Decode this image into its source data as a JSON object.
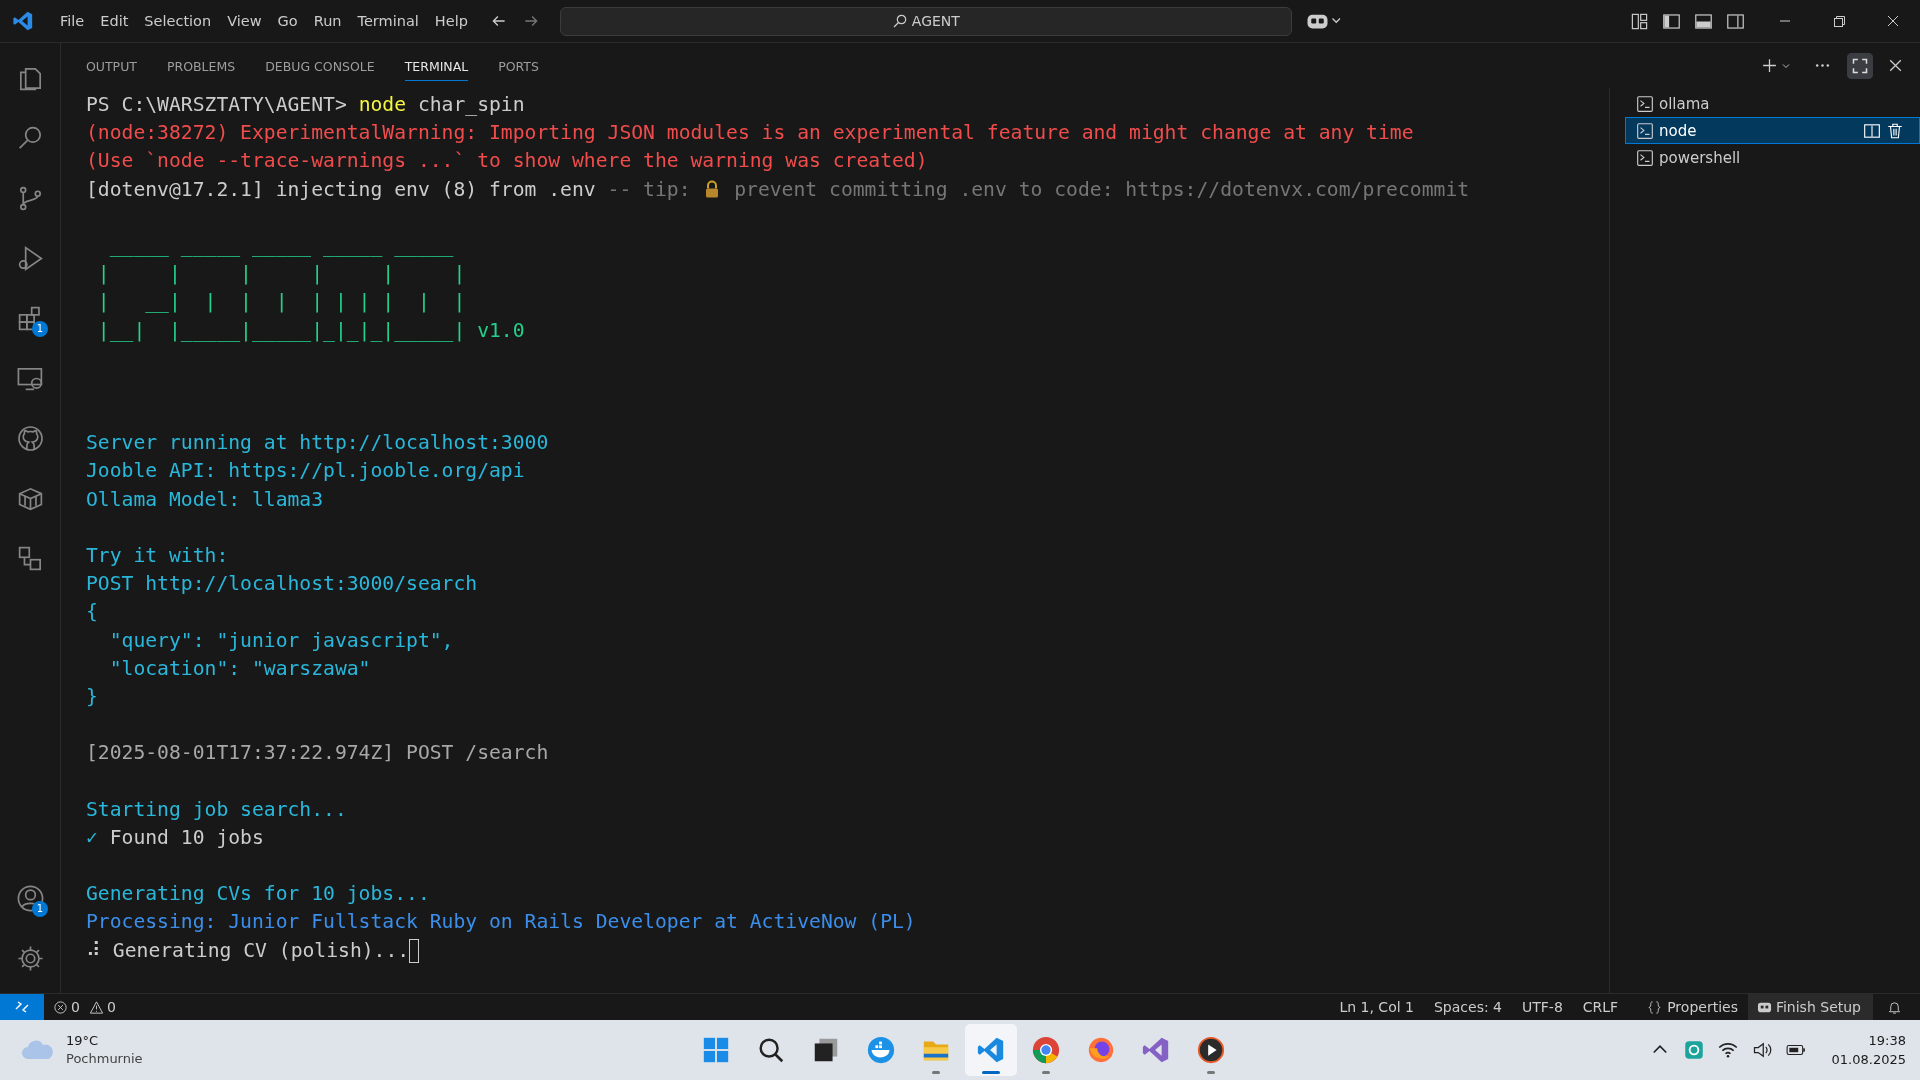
{
  "menu": [
    "File",
    "Edit",
    "Selection",
    "View",
    "Go",
    "Run",
    "Terminal",
    "Help"
  ],
  "command_center": {
    "value": "AGENT"
  },
  "activity_bar": {
    "top": [
      {
        "kind": "files"
      },
      {
        "kind": "search"
      },
      {
        "kind": "source-control"
      },
      {
        "kind": "run-debug"
      },
      {
        "kind": "extensions",
        "badge": "1"
      },
      {
        "kind": "remote"
      },
      {
        "kind": "github"
      },
      {
        "kind": "box"
      },
      {
        "kind": "shapes"
      }
    ],
    "bottom": [
      {
        "kind": "account",
        "badge": "1"
      },
      {
        "kind": "settings"
      }
    ]
  },
  "panel_tabs": [
    {
      "label": "OUTPUT",
      "selected": false
    },
    {
      "label": "PROBLEMS",
      "selected": false
    },
    {
      "label": "DEBUG CONSOLE",
      "selected": false
    },
    {
      "label": "TERMINAL",
      "selected": true
    },
    {
      "label": "PORTS",
      "selected": false
    }
  ],
  "terminal": {
    "lines": [
      {
        "kind": "text",
        "segments": [
          {
            "kind": "plain",
            "text": "PS C:\\WARSZTATY\\AGENT> "
          },
          {
            "kind": "command",
            "text": "node"
          },
          {
            "kind": "plain",
            "text": " char_spin"
          }
        ]
      },
      {
        "kind": "text",
        "segments": [
          {
            "kind": "error",
            "text": "(node:38272) ExperimentalWarning: Importing JSON modules is an experimental feature and might change at any time"
          }
        ]
      },
      {
        "kind": "text",
        "segments": [
          {
            "kind": "error",
            "text": "(Use `node --trace-warnings ...` to show where the warning was created)"
          }
        ]
      },
      {
        "kind": "text",
        "segments": [
          {
            "kind": "plain",
            "text": "[dotenv@17.2.1] injecting env (8) from .env "
          },
          {
            "kind": "dim",
            "text": "-- tip: "
          },
          {
            "kind": "lock"
          },
          {
            "kind": "dim",
            "text": " prevent committing .env to code: https://dotenvx.com/precommit"
          }
        ]
      },
      {
        "kind": "blank"
      },
      {
        "kind": "text",
        "segments": [
          {
            "kind": "art",
            "text": "  _____ _____ _____ _____ _____"
          }
        ]
      },
      {
        "kind": "text",
        "segments": [
          {
            "kind": "art",
            "text": " |     |     |     |     |     |"
          }
        ]
      },
      {
        "kind": "text",
        "segments": [
          {
            "kind": "art",
            "text": " |   __|  |  |  |  | | | |  |  |"
          }
        ]
      },
      {
        "kind": "text",
        "segments": [
          {
            "kind": "art",
            "text": " |__|  |_____|_____|_|_|_|_____|"
          },
          {
            "kind": "art",
            "text": " v1.0"
          }
        ]
      },
      {
        "kind": "blank"
      },
      {
        "kind": "blank"
      },
      {
        "kind": "blank"
      },
      {
        "kind": "text",
        "segments": [
          {
            "kind": "info",
            "text": "Server running at http://localhost:3000"
          }
        ]
      },
      {
        "kind": "text",
        "segments": [
          {
            "kind": "info",
            "text": "Jooble API: https://pl.jooble.org/api"
          }
        ]
      },
      {
        "kind": "text",
        "segments": [
          {
            "kind": "info",
            "text": "Ollama Model: llama3"
          }
        ]
      },
      {
        "kind": "blank"
      },
      {
        "kind": "text",
        "segments": [
          {
            "kind": "info",
            "text": "Try it with:"
          }
        ]
      },
      {
        "kind": "text",
        "segments": [
          {
            "kind": "info",
            "text": "POST http://localhost:3000/search"
          }
        ]
      },
      {
        "kind": "text",
        "segments": [
          {
            "kind": "info",
            "text": "{"
          }
        ]
      },
      {
        "kind": "text",
        "segments": [
          {
            "kind": "info",
            "text": "  \"query\": \"junior javascript\","
          }
        ]
      },
      {
        "kind": "text",
        "segments": [
          {
            "kind": "info",
            "text": "  \"location\": \"warszawa\""
          }
        ]
      },
      {
        "kind": "text",
        "segments": [
          {
            "kind": "info",
            "text": "}"
          }
        ]
      },
      {
        "kind": "blank"
      },
      {
        "kind": "text",
        "segments": [
          {
            "kind": "gray",
            "text": "[2025-08-01T17:37:22.974Z] POST /search"
          }
        ]
      },
      {
        "kind": "blank"
      },
      {
        "kind": "text",
        "segments": [
          {
            "kind": "info",
            "text": "Starting job search..."
          }
        ]
      },
      {
        "kind": "text",
        "segments": [
          {
            "kind": "info",
            "text": "✓"
          },
          {
            "kind": "plain",
            "text": " Found 10 jobs"
          }
        ]
      },
      {
        "kind": "blank"
      },
      {
        "kind": "text",
        "segments": [
          {
            "kind": "info",
            "text": "Generating CVs for 10 jobs..."
          }
        ]
      },
      {
        "kind": "text",
        "segments": [
          {
            "kind": "blue",
            "text": "Processing: Junior Fullstack Ruby on Rails Developer at ActiveNow (PL)"
          }
        ]
      },
      {
        "kind": "text",
        "segments": [
          {
            "kind": "plain",
            "text": "⠼ Generating CV (polish)..."
          },
          {
            "kind": "cursor"
          }
        ]
      }
    ]
  },
  "terminal_list": [
    {
      "name": "ollama",
      "selected": false
    },
    {
      "name": "node",
      "selected": true
    },
    {
      "name": "powershell",
      "selected": false
    }
  ],
  "status_bar": {
    "errors": "0",
    "warnings": "0",
    "right": [
      "Ln 1, Col 1",
      "Spaces: 4",
      "UTF-8",
      "CRLF"
    ],
    "properties": "Properties",
    "finish_setup": "Finish Setup"
  },
  "taskbar": {
    "weather": {
      "temperature": "19°C",
      "condition": "Pochmurnie"
    },
    "apps": [
      {
        "kind": "start",
        "running": false,
        "selected": false
      },
      {
        "kind": "search",
        "running": false,
        "selected": false
      },
      {
        "kind": "taskview",
        "running": false,
        "selected": false
      },
      {
        "kind": "whale",
        "running": false,
        "selected": false
      },
      {
        "kind": "folder",
        "running": true,
        "selected": false
      },
      {
        "kind": "vscode",
        "running": true,
        "selected": true
      },
      {
        "kind": "chrome",
        "running": true,
        "selected": false
      },
      {
        "kind": "firefox",
        "running": false,
        "selected": false
      },
      {
        "kind": "vs",
        "running": false,
        "selected": false
      },
      {
        "kind": "player",
        "running": true,
        "selected": false
      }
    ],
    "time": "19:38",
    "date": "01.08.2025"
  }
}
